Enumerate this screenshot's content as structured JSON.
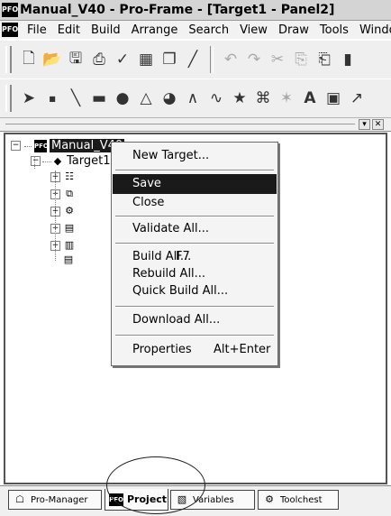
{
  "window": {
    "title": "Manual_V40 - Pro-Frame - [Target1 - Panel2]",
    "app_icon": "PFO"
  },
  "menubar": {
    "items": [
      "File",
      "Edit",
      "Build",
      "Arrange",
      "Search",
      "View",
      "Draw",
      "Tools",
      "Window"
    ]
  },
  "toolbar1": {
    "icons": [
      "new-page-icon",
      "open-folder-icon",
      "save-disk-icon",
      "print-icon",
      "check-icon",
      "calendar-icon",
      "copy-page-icon",
      "chart-icon",
      "undo-icon",
      "redo-icon",
      "cut-icon",
      "copy-icon",
      "paste-icon",
      "delete-icon"
    ]
  },
  "toolbar2": {
    "icons": [
      "pointer-icon",
      "dot-icon",
      "line-icon",
      "rectangle-icon",
      "ellipse-icon",
      "polygon-icon",
      "pie-icon",
      "polyline-icon",
      "curve-icon",
      "star-icon",
      "snap-icon",
      "pattern-icon",
      "text-icon",
      "image-icon",
      "trend-icon"
    ]
  },
  "tree": {
    "root_label": "Manual_V40",
    "target_label": "Target1"
  },
  "context_menu": {
    "items": [
      {
        "label": "New Target...",
        "shortcut": ""
      },
      {
        "label": "Save",
        "shortcut": "",
        "highlighted": true
      },
      {
        "label": "Close",
        "shortcut": ""
      },
      {
        "label": "Validate All...",
        "shortcut": ""
      },
      {
        "label": "Build All...",
        "shortcut": "F7"
      },
      {
        "label": "Rebuild All...",
        "shortcut": ""
      },
      {
        "label": "Quick Build All...",
        "shortcut": ""
      },
      {
        "label": "Download All...",
        "shortcut": ""
      },
      {
        "label": "Properties",
        "shortcut": "Alt+Enter"
      }
    ]
  },
  "tabs": [
    {
      "label": "Pro-Manager",
      "icon": "manager-icon",
      "active": false
    },
    {
      "label": "Project",
      "icon": "project-icon",
      "active": true
    },
    {
      "label": "Variables",
      "icon": "variables-icon",
      "active": false
    },
    {
      "label": "Toolchest",
      "icon": "toolchest-icon",
      "active": false
    }
  ],
  "colors": {
    "highlight": "#1a1a1a",
    "menu_bg": "#f4f4f4",
    "panel_border": "#555555"
  }
}
